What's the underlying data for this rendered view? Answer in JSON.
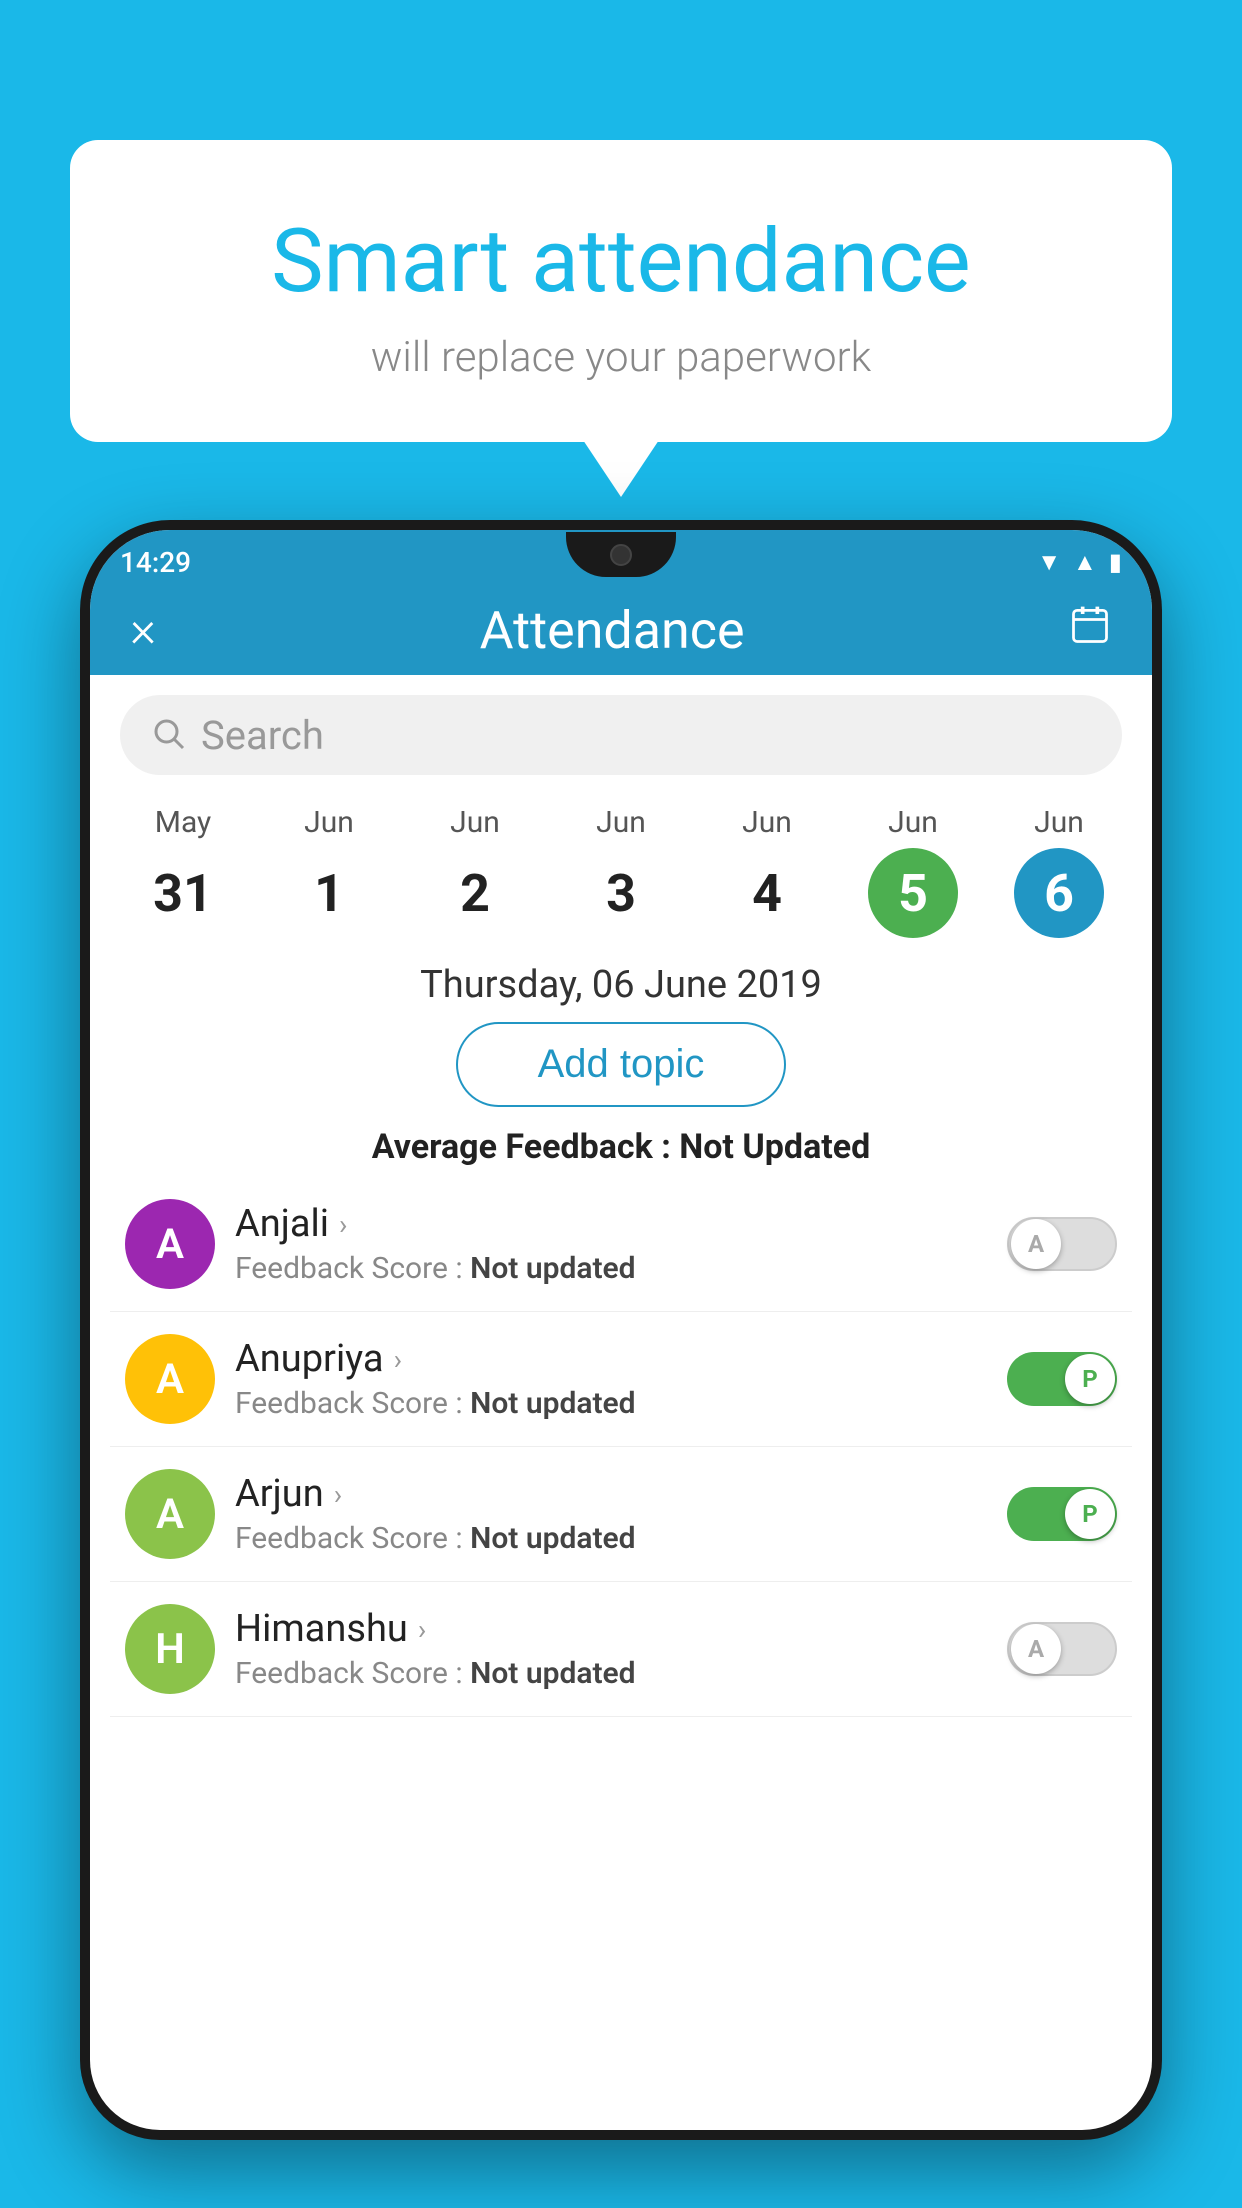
{
  "background_color": "#1ab8e8",
  "bubble": {
    "title": "Smart attendance",
    "subtitle": "will replace your paperwork"
  },
  "phone": {
    "time": "14:29",
    "header": {
      "title": "Attendance",
      "close_label": "×",
      "calendar_icon": "calendar-icon"
    },
    "search": {
      "placeholder": "Search"
    },
    "calendar": {
      "days": [
        {
          "month": "May",
          "num": "31",
          "selected": ""
        },
        {
          "month": "Jun",
          "num": "1",
          "selected": ""
        },
        {
          "month": "Jun",
          "num": "2",
          "selected": ""
        },
        {
          "month": "Jun",
          "num": "3",
          "selected": ""
        },
        {
          "month": "Jun",
          "num": "4",
          "selected": ""
        },
        {
          "month": "Jun",
          "num": "5",
          "selected": "green"
        },
        {
          "month": "Jun",
          "num": "6",
          "selected": "blue"
        }
      ]
    },
    "selected_date": "Thursday, 06 June 2019",
    "add_topic_label": "Add topic",
    "avg_feedback_label": "Average Feedback :",
    "avg_feedback_value": "Not Updated",
    "students": [
      {
        "name": "Anjali",
        "avatar_letter": "A",
        "avatar_color": "#9c27b0",
        "feedback_label": "Feedback Score :",
        "feedback_value": "Not updated",
        "toggle": "off",
        "toggle_letter": "A"
      },
      {
        "name": "Anupriya",
        "avatar_letter": "A",
        "avatar_color": "#ffc107",
        "feedback_label": "Feedback Score :",
        "feedback_value": "Not updated",
        "toggle": "on",
        "toggle_letter": "P"
      },
      {
        "name": "Arjun",
        "avatar_letter": "A",
        "avatar_color": "#8bc34a",
        "feedback_label": "Feedback Score :",
        "feedback_value": "Not updated",
        "toggle": "on",
        "toggle_letter": "P"
      },
      {
        "name": "Himanshu",
        "avatar_letter": "H",
        "avatar_color": "#8bc34a",
        "feedback_label": "Feedback Score :",
        "feedback_value": "Not updated",
        "toggle": "off",
        "toggle_letter": "A"
      }
    ]
  }
}
